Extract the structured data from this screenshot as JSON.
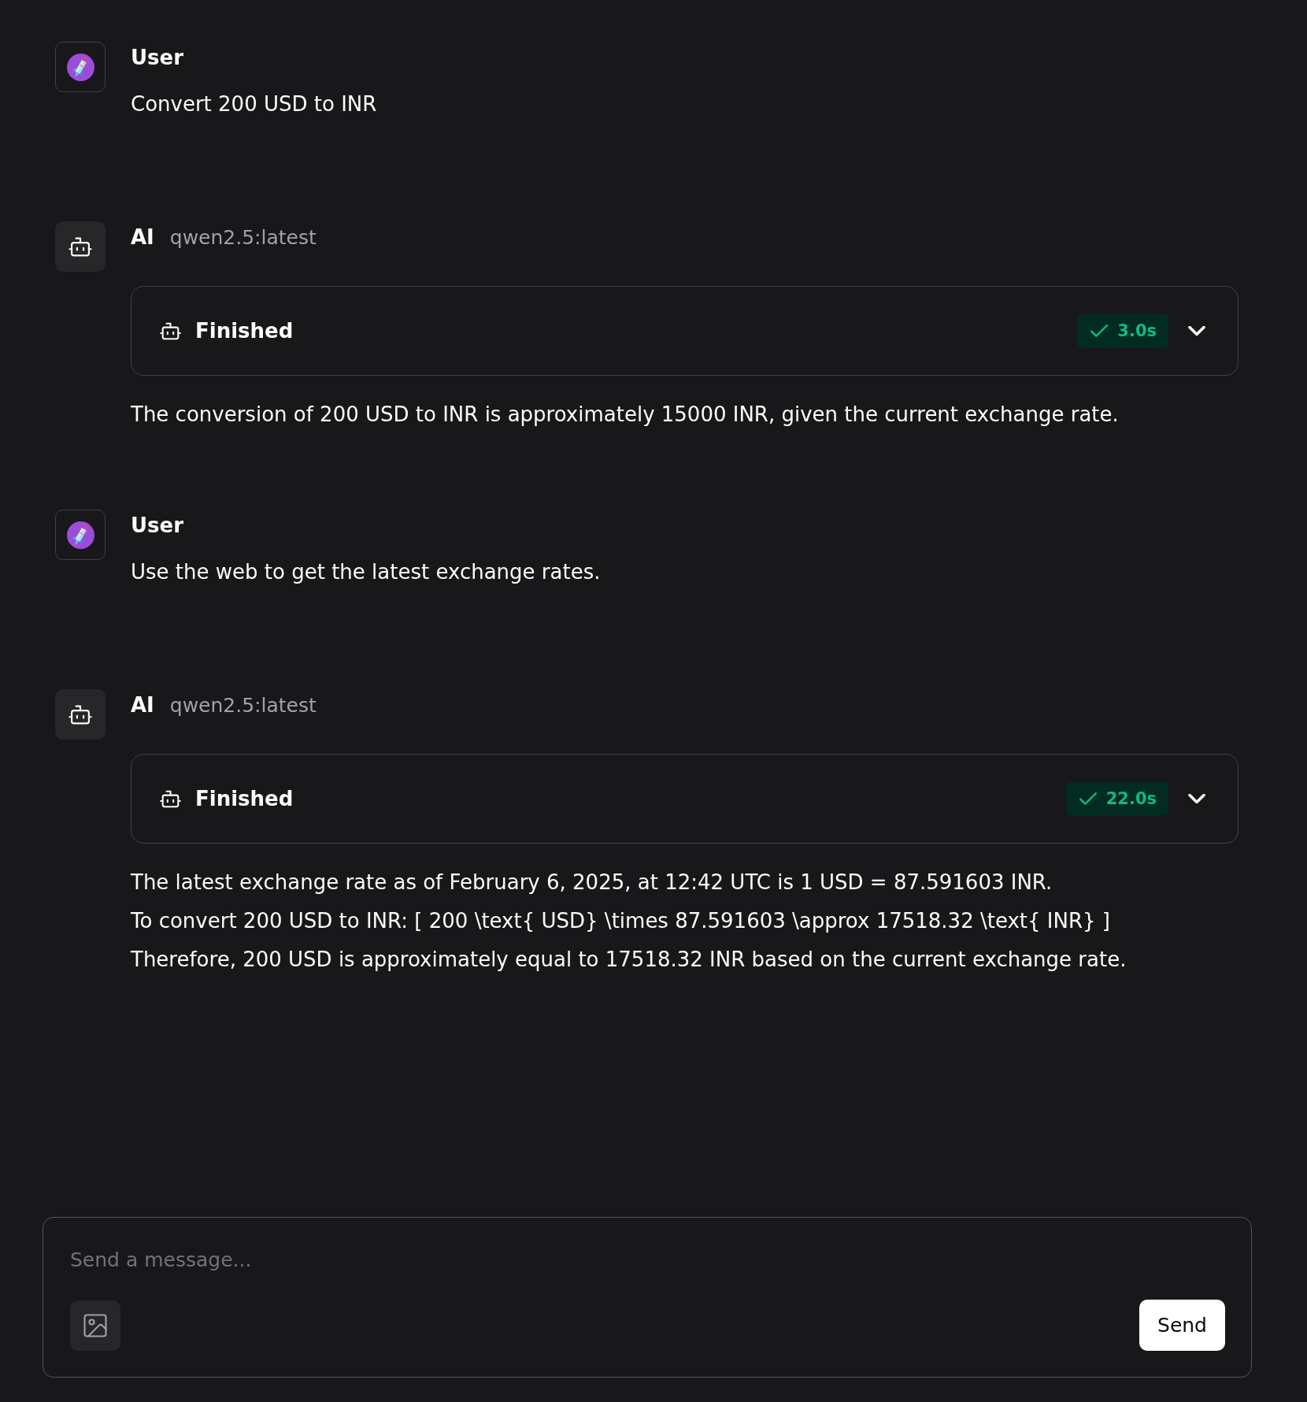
{
  "messages": [
    {
      "kind": "user",
      "name": "User",
      "lines": [
        "Convert 200 USD to INR"
      ]
    },
    {
      "kind": "ai",
      "name": "AI",
      "model": "qwen2.5:latest",
      "status": {
        "label": "Finished",
        "duration": "3.0s",
        "expanded": false
      },
      "lines": [
        "The conversion of 200 USD to INR is approximately 15000 INR, given the current exchange rate."
      ]
    },
    {
      "kind": "user",
      "name": "User",
      "lines": [
        "Use the web to get the latest exchange rates."
      ]
    },
    {
      "kind": "ai",
      "name": "AI",
      "model": "qwen2.5:latest",
      "status": {
        "label": "Finished",
        "duration": "22.0s",
        "expanded": false
      },
      "lines": [
        "The latest exchange rate as of February 6, 2025, at 12:42 UTC is 1 USD = 87.591603 INR.",
        "To convert 200 USD to INR: [ 200 \\text{ USD} \\times 87.591603 \\approx 17518.32 \\text{ INR} ]",
        "Therefore, 200 USD is approximately equal to 17518.32 INR based on the current exchange rate."
      ]
    }
  ],
  "composer": {
    "placeholder": "Send a message...",
    "send_label": "Send"
  }
}
